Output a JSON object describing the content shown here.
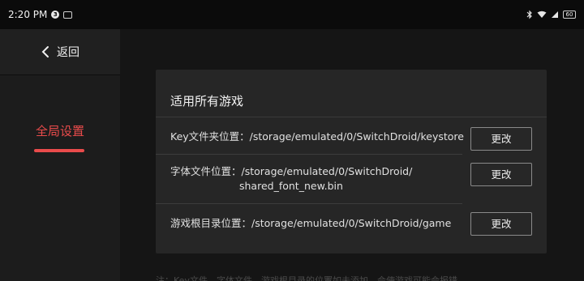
{
  "status_bar": {
    "time": "2:20 PM",
    "battery": "60"
  },
  "sidebar": {
    "back_label": "返回",
    "items": [
      {
        "label": "全局设置",
        "selected": true
      }
    ]
  },
  "card": {
    "title": "适用所有游戏",
    "rows": [
      {
        "label": "Key文件夹位置：/storage/emulated/0/SwitchDroid/keystore",
        "button": "更改"
      },
      {
        "label_line1": "字体文件位置：/storage/emulated/0/SwitchDroid/",
        "label_line2": "shared_font_new.bin",
        "button": "更改"
      },
      {
        "label": "游戏根目录位置：/storage/emulated/0/SwitchDroid/game",
        "button": "更改"
      }
    ]
  },
  "footnote": "注：Key文件、字体文件、游戏根目录的位置如未添加，会使游戏可能会报错",
  "colors": {
    "accent": "#e94b4b",
    "background": "#151515",
    "card": "#262626"
  }
}
